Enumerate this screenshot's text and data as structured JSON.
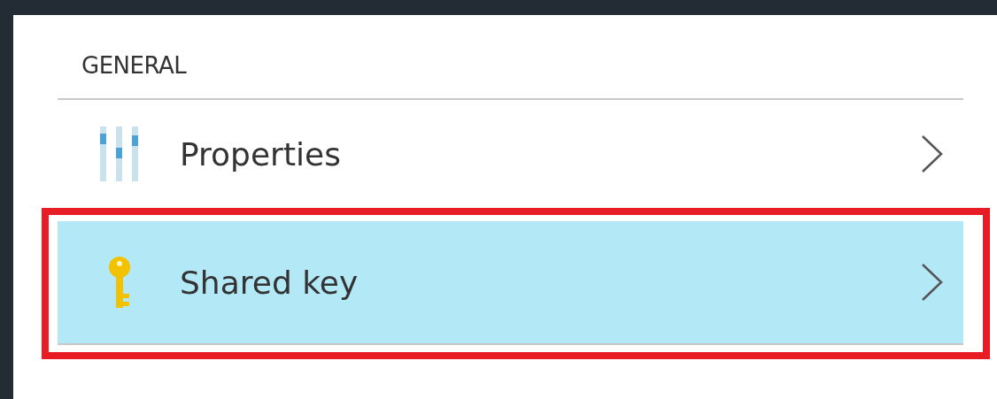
{
  "section": {
    "title": "GENERAL"
  },
  "items": [
    {
      "label": "Properties",
      "kind": "sliders",
      "selected": false,
      "highlighted": false
    },
    {
      "label": "Shared key",
      "kind": "key",
      "selected": true,
      "highlighted": true
    }
  ]
}
